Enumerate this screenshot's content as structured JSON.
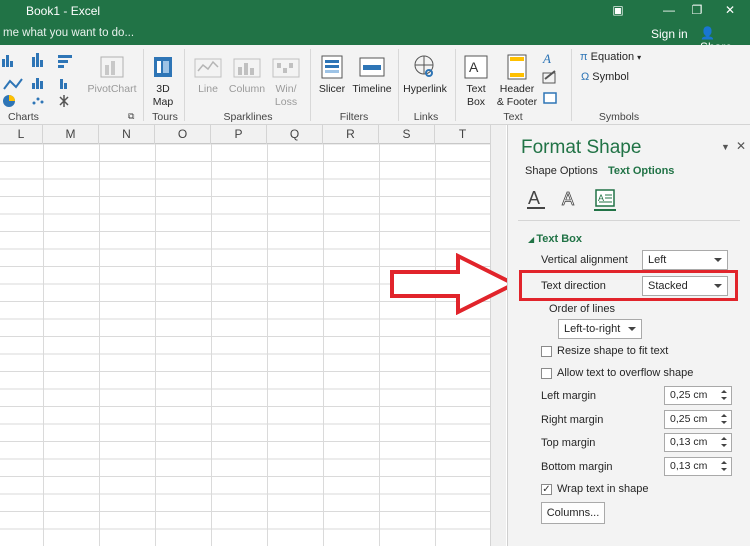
{
  "window": {
    "title": "Book1 - Excel",
    "tell_me": "me what you want to do...",
    "sign_in": "Sign in",
    "share": "Share"
  },
  "ribbon": {
    "pivotchart": "PivotChart",
    "map3d_line1": "3D",
    "map3d_line2": "Map",
    "sparkline_line": "Line",
    "sparkline_column": "Column",
    "winloss_line1": "Win/",
    "winloss_line2": "Loss",
    "slicer": "Slicer",
    "timeline": "Timeline",
    "hyperlink": "Hyperlink",
    "textbox_line1": "Text",
    "textbox_line2": "Box",
    "header_line1": "Header",
    "header_line2": "& Footer",
    "equation": "Equation",
    "symbol": "Symbol",
    "groups": {
      "charts": "Charts",
      "tours": "Tours",
      "sparklines": "Sparklines",
      "filters": "Filters",
      "links": "Links",
      "text": "Text",
      "symbols": "Symbols"
    }
  },
  "sheet": {
    "columns": [
      "L",
      "M",
      "N",
      "O",
      "P",
      "Q",
      "R",
      "S",
      "T"
    ]
  },
  "pane": {
    "title": "Format Shape",
    "tab_shape": "Shape Options",
    "tab_text": "Text Options",
    "section": "Text Box",
    "vertical_alignment_label": "Vertical alignment",
    "vertical_alignment_value": "Left",
    "text_direction_label": "Text direction",
    "text_direction_value": "Stacked",
    "order_of_lines_label": "Order of lines",
    "order_of_lines_value": "Left-to-right",
    "resize_label": "Resize shape to fit text",
    "overflow_label": "Allow text to overflow shape",
    "left_margin_label": "Left margin",
    "left_margin_value": "0,25 cm",
    "right_margin_label": "Right margin",
    "right_margin_value": "0,25 cm",
    "top_margin_label": "Top margin",
    "top_margin_value": "0,13 cm",
    "bottom_margin_label": "Bottom margin",
    "bottom_margin_value": "0,13 cm",
    "wrap_label": "Wrap text in shape",
    "columns_button": "Columns..."
  },
  "colors": {
    "brand": "#217346",
    "highlight": "#e1242b"
  },
  "state": {
    "resize_checked": false,
    "overflow_checked": false,
    "wrap_checked": true
  }
}
